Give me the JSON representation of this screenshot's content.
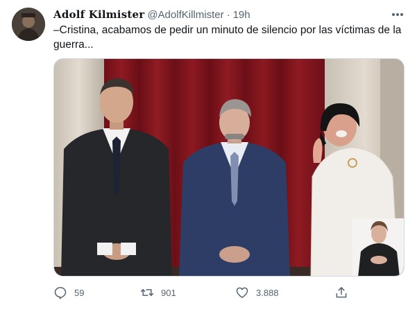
{
  "tweet": {
    "author": {
      "display_name": "Adolf Kilmister",
      "handle": "@AdolfKillmister",
      "avatar_icon": "user-avatar"
    },
    "separator": "·",
    "timestamp": "19h",
    "more_icon": "more-horizontal-icon",
    "text": "–Cristina, acabamos de pedir un minuto de silencio por las víctimas de la guerra...",
    "media": {
      "type": "photo"
    },
    "actions": {
      "reply": {
        "icon": "reply-icon",
        "count": "59"
      },
      "retweet": {
        "icon": "retweet-icon",
        "count": "901"
      },
      "like": {
        "icon": "heart-icon",
        "count": "3.888"
      },
      "share": {
        "icon": "share-icon"
      }
    }
  },
  "colors": {
    "text_primary": "#0f1419",
    "text_secondary": "#536471",
    "border": "#cfd9de",
    "background": "#ffffff"
  }
}
